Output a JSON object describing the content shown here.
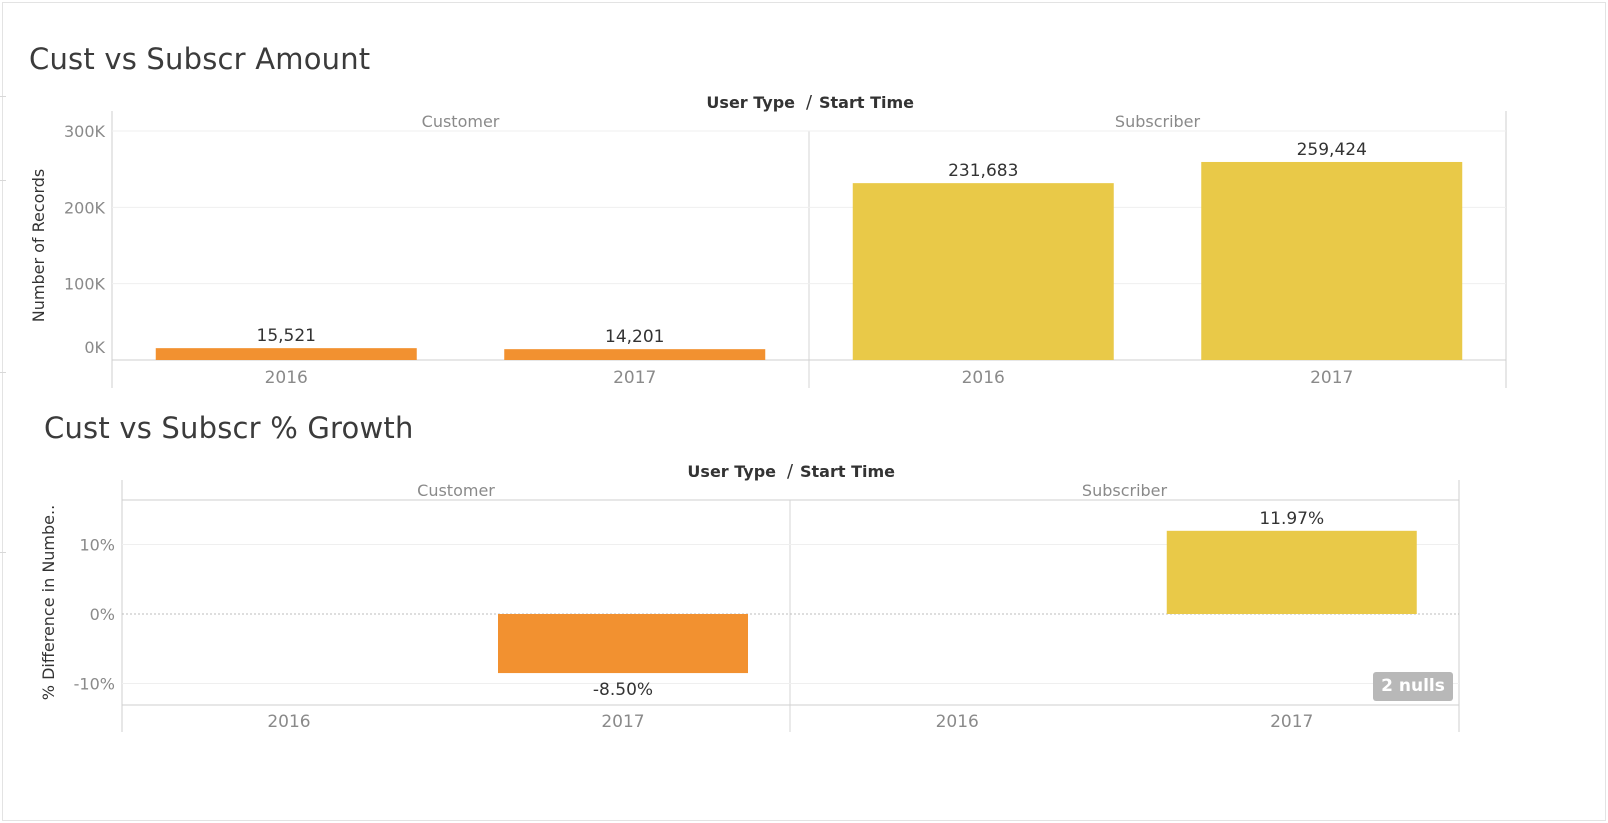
{
  "colors": {
    "customer": "#f29130",
    "subscriber": "#e9c948"
  },
  "chart_data": [
    {
      "type": "bar",
      "title": "Cust vs Subscr Amount",
      "header": "User Type / Start Time",
      "ylabel": "Number of Records",
      "ylim": [
        0,
        300000
      ],
      "yticks": [
        {
          "value": 300000,
          "label": "300K"
        },
        {
          "value": 200000,
          "label": "200K"
        },
        {
          "value": 100000,
          "label": "100K"
        },
        {
          "value": 0,
          "label": "0K"
        }
      ],
      "panes": [
        {
          "name": "Customer",
          "categories": [
            "2016",
            "2017"
          ],
          "values": [
            15521,
            14201
          ],
          "labels": [
            "15,521",
            "14,201"
          ],
          "color": "#f29130"
        },
        {
          "name": "Subscriber",
          "categories": [
            "2016",
            "2017"
          ],
          "values": [
            231683,
            259424
          ],
          "labels": [
            "231,683",
            "259,424"
          ],
          "color": "#e9c948"
        }
      ]
    },
    {
      "type": "bar",
      "title": "Cust vs Subscr % Growth",
      "header": "User Type / Start Time",
      "ylabel": "% Difference in Numbe..",
      "ylim": [
        -13,
        18
      ],
      "yticks": [
        {
          "value": 10,
          "label": "10%"
        },
        {
          "value": 0,
          "label": "0%"
        },
        {
          "value": -10,
          "label": "-10%"
        }
      ],
      "panes": [
        {
          "name": "Customer",
          "categories": [
            "2016",
            "2017"
          ],
          "values": [
            null,
            -8.5
          ],
          "labels": [
            "",
            "-8.50%"
          ],
          "color": "#f29130"
        },
        {
          "name": "Subscriber",
          "categories": [
            "2016",
            "2017"
          ],
          "values": [
            null,
            11.97
          ],
          "labels": [
            "",
            "11.97%"
          ],
          "color": "#e9c948"
        }
      ],
      "nulls_indicator": "2 nulls"
    }
  ]
}
